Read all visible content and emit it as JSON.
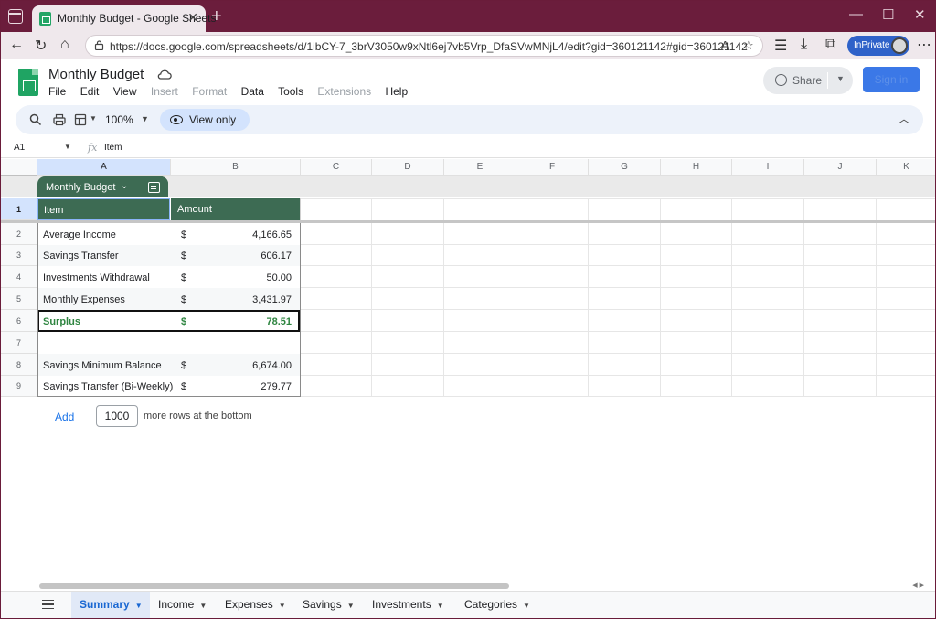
{
  "browser": {
    "tab_title": "Monthly Budget - Google Sheets",
    "url": "https://docs.google.com/spreadsheets/d/1ibCY-7_3brV3050w9xNtl6ej7vb5Vrp_DfaSVwMNjL4/edit?gid=360121142#gid=360121142",
    "profile_label": "InPrivate"
  },
  "doc": {
    "title": "Monthly Budget",
    "menus": [
      {
        "label": "File",
        "enabled": true
      },
      {
        "label": "Edit",
        "enabled": true
      },
      {
        "label": "View",
        "enabled": true
      },
      {
        "label": "Insert",
        "enabled": false
      },
      {
        "label": "Format",
        "enabled": false
      },
      {
        "label": "Data",
        "enabled": true
      },
      {
        "label": "Tools",
        "enabled": true
      },
      {
        "label": "Extensions",
        "enabled": false
      },
      {
        "label": "Help",
        "enabled": true
      }
    ],
    "share_label": "Share",
    "signin_label": "Sign in"
  },
  "toolbar": {
    "zoom": "100%",
    "view_only_label": "View only"
  },
  "formula_bar": {
    "cell_ref": "A1",
    "fx": "fx",
    "value": "Item"
  },
  "grid": {
    "columns": [
      "A",
      "B",
      "C",
      "D",
      "E",
      "F",
      "G",
      "H",
      "I",
      "J",
      "K"
    ],
    "rows": [
      "1",
      "2",
      "3",
      "4",
      "5",
      "6",
      "7",
      "8",
      "9"
    ],
    "table_name": "Monthly Budget",
    "headers": {
      "item": "Item",
      "amount": "Amount"
    },
    "body": [
      {
        "item": "Average Income",
        "currency": "$",
        "amount": "4,166.65"
      },
      {
        "item": "Savings Transfer",
        "currency": "$",
        "amount": "606.17"
      },
      {
        "item": "Investments Withdrawal",
        "currency": "$",
        "amount": "50.00"
      },
      {
        "item": "Monthly Expenses",
        "currency": "$",
        "amount": "3,431.97"
      },
      {
        "item": "Surplus",
        "currency": "$",
        "amount": "78.51"
      },
      {
        "item": "",
        "currency": "",
        "amount": ""
      },
      {
        "item": "Savings Minimum Balance",
        "currency": "$",
        "amount": "6,674.00"
      },
      {
        "item": "Savings Transfer (Bi-Weekly)",
        "currency": "$",
        "amount": "279.77"
      }
    ],
    "add_rows": {
      "add_label": "Add",
      "count": "1000",
      "suffix": "more rows at the bottom"
    }
  },
  "sheet_tabs": [
    {
      "label": "Summary",
      "active": true
    },
    {
      "label": "Income",
      "active": false
    },
    {
      "label": "Expenses",
      "active": false
    },
    {
      "label": "Savings",
      "active": false
    },
    {
      "label": "Investments",
      "active": false
    },
    {
      "label": "Categories",
      "active": false
    }
  ],
  "colors": {
    "table_header": "#3d6b53",
    "surplus_text": "#2e8540",
    "browser_frame": "#6b1d3c",
    "accent_blue": "#1a73e8"
  }
}
